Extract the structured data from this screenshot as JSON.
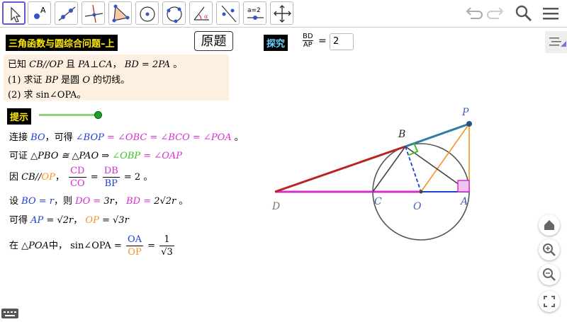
{
  "toolbar": {
    "tools": [
      "move-tool",
      "point-tool",
      "line-tool",
      "perpendicular-tool",
      "polygon-tool",
      "circle-center-tool",
      "circle-three-points-tool",
      "angle-tool",
      "reflect-tool",
      "slider-tool",
      "move-graphics-tool"
    ],
    "slider_tool_label": "a=2",
    "point_tool_label": "A",
    "right_icons": [
      "undo-icon",
      "redo-icon",
      "search-icon",
      "menu-icon"
    ]
  },
  "title": "三角函数与圆综合问题–上",
  "original_button": "原题",
  "explore_label": "探究",
  "ratio": {
    "num": "BD",
    "den": "AP",
    "eq": "=",
    "value": "2"
  },
  "problem": {
    "line1": {
      "a": "已知",
      "b": "CB//OP",
      "c": "且",
      "d": "PA⊥CA",
      "e": "，",
      "f": "BD = 2PA",
      "g": "。"
    },
    "line2": {
      "a": "(1) 求证",
      "b": "BP",
      "c": "是圆",
      "d": "O",
      "e": "的切线。"
    },
    "line3": {
      "a": "(2) 求",
      "b": "sin∠OPA",
      "c": "。"
    }
  },
  "hint_label": "提示",
  "hint_slider_value": 1.0,
  "solution": {
    "s1": {
      "a": "连接",
      "b": "BO",
      "c": "，可得",
      "d": "∠BOP",
      "e": " = ∠OBC",
      "f": " = ∠BCO",
      "g": " = ∠POA",
      "h": "。"
    },
    "s2": {
      "a": "可证",
      "b": "△PBO ≅ △PAO ⇒",
      "c": "∠OBP",
      "d": " = ∠OAP"
    },
    "s3": {
      "a": "因",
      "b": "CB//",
      "c": "OP",
      "d": "，",
      "e1n": "CD",
      "e1d": "CO",
      "eq1": "=",
      "e2n": "DB",
      "e2d": "BP",
      "f": "= 2 。"
    },
    "s4": {
      "a": "设",
      "b": "BO = r",
      "c": "，则",
      "d": "DO =",
      "e": "3r",
      "f": "，",
      "g": "BD =",
      "h": "2√2r",
      "i": "。"
    },
    "s5": {
      "a": "可得",
      "b": "AP",
      "c": "=",
      "d": "√2r",
      "e": "，",
      "f": "OP",
      "g": "=",
      "h": "√3r"
    },
    "s6": {
      "a": "在",
      "b": "△POA",
      "c": "中，",
      "d": "sin∠OPA =",
      "e1n": "OA",
      "e1d": "OP",
      "eq": "=",
      "e2n": "1",
      "e2d": "√3"
    }
  },
  "points": {
    "P": "P",
    "B": "B",
    "D": "D",
    "C": "C",
    "O": "O",
    "A": "A"
  },
  "colors": {
    "BD": "#bb2222",
    "BP": "#2f7ea0",
    "DA": "#d62dcf",
    "OA": "#1c3fd6",
    "OP": "#f5941d",
    "PA": "#f5941d",
    "circle": "#555555",
    "angle_green": "#3dbf26",
    "angle_mag": "#d62dcf"
  },
  "zoom_buttons": [
    "home-icon",
    "zoom-in-icon",
    "zoom-out-icon",
    "fullscreen-icon"
  ]
}
